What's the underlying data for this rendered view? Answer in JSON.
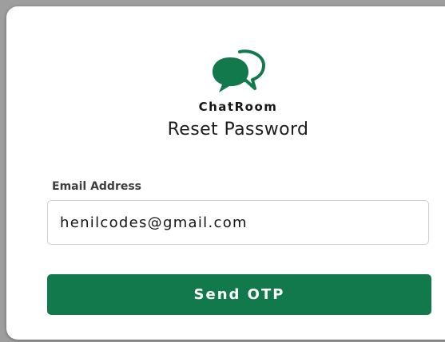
{
  "brand": {
    "name": "ChatRoom",
    "icon": "chat-bubbles-icon",
    "color": "#12794d"
  },
  "page": {
    "title": "Reset Password"
  },
  "form": {
    "email_label": "Email Address",
    "email_value": "henilcodes@gmail.com",
    "submit_label": "Send OTP"
  },
  "colors": {
    "accent": "#12794d",
    "background": "#9e9e9e",
    "card": "#ffffff"
  }
}
